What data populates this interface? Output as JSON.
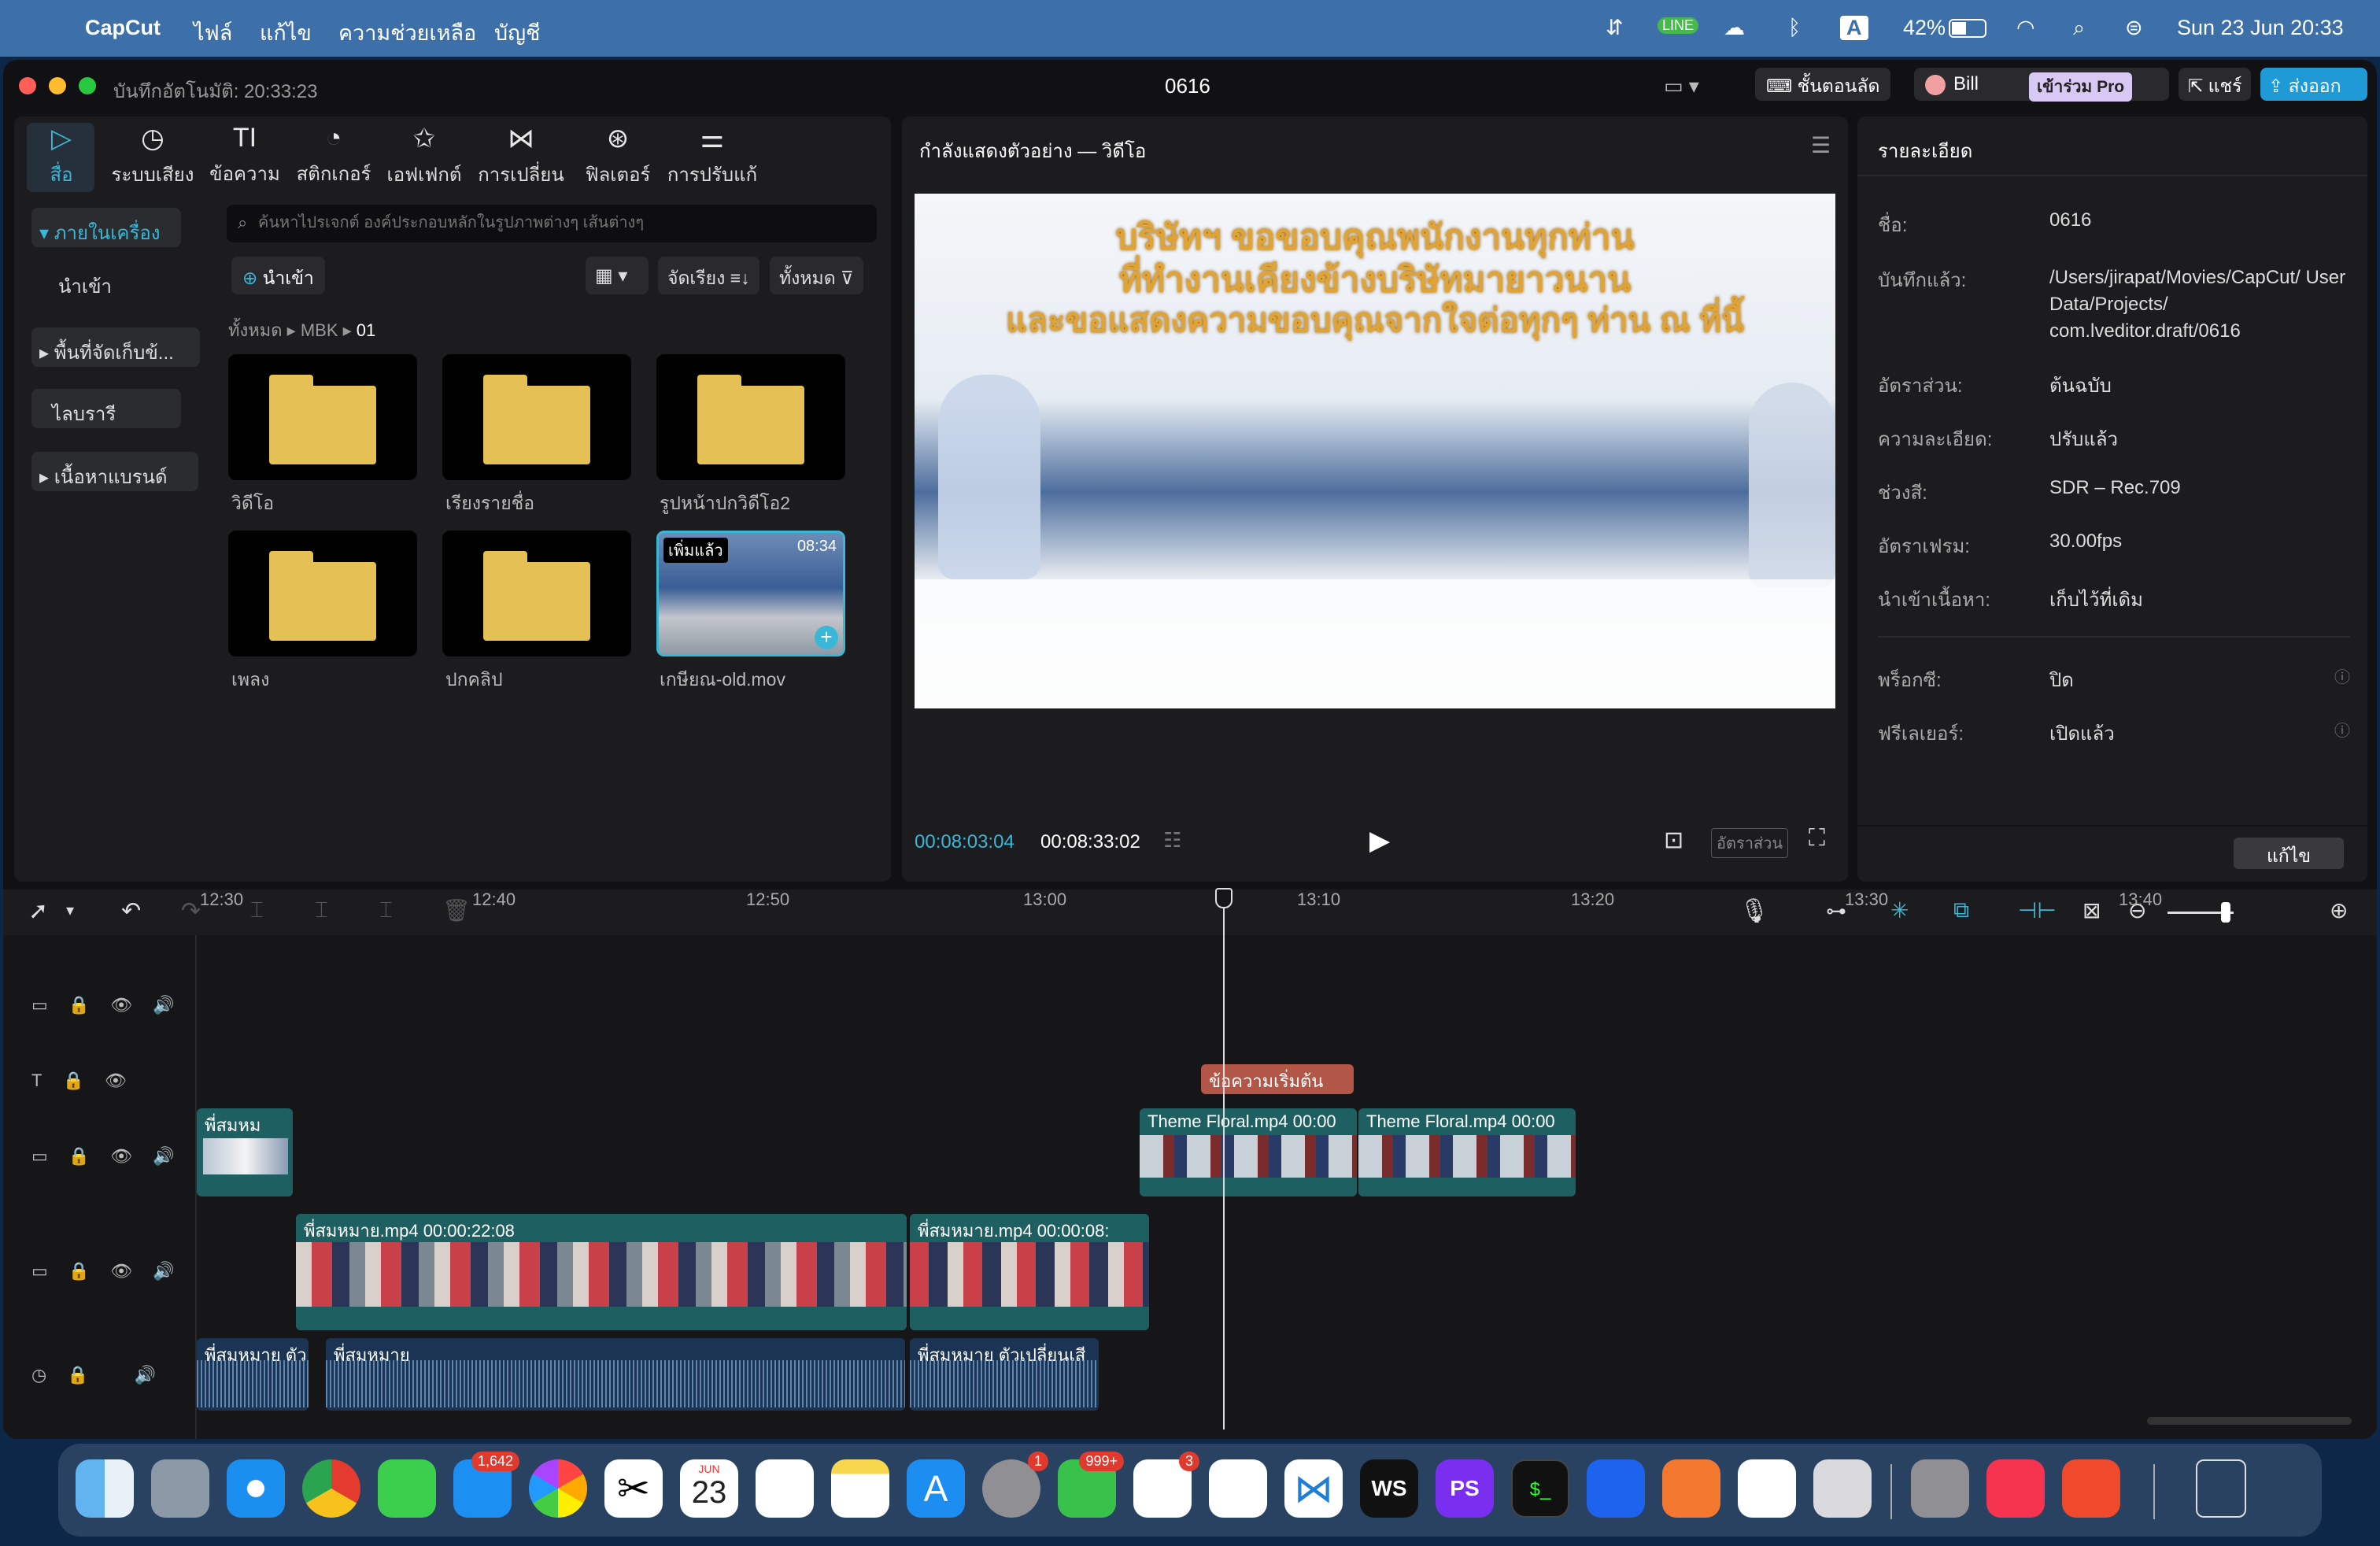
{
  "menubar": {
    "apple": "",
    "app": "CapCut",
    "items": [
      "ไฟล์",
      "แก้ไข",
      "ความช่วยเหลือ",
      "บัญชี"
    ],
    "battery": "42%",
    "clock": "Sun 23 Jun  20:33",
    "input": "A"
  },
  "window": {
    "autosave": "บันทึกอัตโนมัติ: 20:33:23",
    "project_title": "0616",
    "shortcuts": "ชั้นตอนลัด",
    "user": "Bill",
    "pro": "เข้าร่วม Pro",
    "share": "แชร์",
    "export": "ส่งออก"
  },
  "toolbar": [
    "สื่อ",
    "ระบบเสียง",
    "ข้อความ",
    "สติกเกอร์",
    "เอฟเฟกต์",
    "การเปลี่ยน",
    "ฟิลเตอร์",
    "การปรับแก้"
  ],
  "sidebar": {
    "local": "ภายในเครื่อง",
    "import": "นำเข้า",
    "space": "พื้นที่จัดเก็บข้...",
    "library": "ไลบรารี",
    "brand": "เนื้อหาแบรนด์"
  },
  "media": {
    "search_placeholder": "ค้นหาไปรเจกต์ องค์ประกอบหลักในรูปภาพต่างๆ เส้นต่างๆ",
    "import_btn": "นำเข้า",
    "sort": "จัดเรียง",
    "filter": "ทั้งหมด",
    "breadcrumb": [
      "ทั้งหมด",
      "MBK",
      "01"
    ],
    "folders": [
      "วิดีโอ",
      "เรียงรายชื่อ",
      "รูปหน้าปกวิดีโอ2",
      "เพลง",
      "ปกคลิป"
    ],
    "video": {
      "name": "เกษียณ-old.mov",
      "badge": "เพิ่มแล้ว",
      "duration": "08:34"
    }
  },
  "preview": {
    "header": "กำลังแสดงตัวอย่าง — วิดีโอ",
    "line1": "บริษัทฯ ขอขอบคุณพนักงานทุกท่าน",
    "line2": "ที่ทำงานเคียงข้างบริษัทมายาวนาน",
    "line3": "และขอแสดงความขอบคุณจากใจต่อทุกๆ ท่าน ณ ที่นี้",
    "time_current": "00:08:03:04",
    "time_total": "00:08:33:02",
    "ratio": "อัตราส่วน"
  },
  "details": {
    "header": "รายละเอียด",
    "rows": [
      {
        "k": "ชื่อ:",
        "v": "0616"
      },
      {
        "k": "บันทึกแล้ว:",
        "v": "/Users/jirapat/Movies/CapCut/ User Data/Projects/ com.lveditor.draft/0616"
      },
      {
        "k": "อัตราส่วน:",
        "v": "ต้นฉบับ"
      },
      {
        "k": "ความละเอียด:",
        "v": "ปรับแล้ว"
      },
      {
        "k": "ช่วงสี:",
        "v": "SDR – Rec.709"
      },
      {
        "k": "อัตราเฟรม:",
        "v": "30.00fps"
      },
      {
        "k": "นำเข้าเนื้อหา:",
        "v": "เก็บไว้ที่เดิม"
      },
      {
        "k": "พร็อกซี:",
        "v": "ปิด"
      },
      {
        "k": "ฟรีเลเยอร์:",
        "v": "เปิดแล้ว"
      }
    ],
    "edit": "แก้ไข"
  },
  "timeline": {
    "ticks": [
      "12:30",
      "12:40",
      "12:50",
      "13:00",
      "13:10",
      "13:20",
      "13:30",
      "13:40"
    ],
    "text_clip": "ข้อความเริ่มต้น",
    "clip_a": "พี่สมหม",
    "clip_theme1": "Theme  Floral.mp4  00:00",
    "clip_theme2": "Theme  Floral.mp4  00:00",
    "clip_main1": "พี่สมหมาย.mp4   00:00:22:08",
    "clip_main2": "พี่สมหมาย.mp4   00:00:08:",
    "audio1": "พี่สมหมาย    ตัว",
    "audio2": "พี่สมหมาย",
    "audio3": "พี่สมหมาย    ตัวเปลี่ยนเสี"
  },
  "dock": {
    "mail_badge": "1,642",
    "settings_badge": "1",
    "line_badge": "999+",
    "slack_badge": "3",
    "cal_month": "JUN",
    "cal_day": "23",
    "ws": "WS",
    "ps": "PS",
    "term": "$_"
  },
  "colors": {
    "accent": "#3ab7d6",
    "export": "#1f9ad6",
    "text_clip": "#b25748"
  }
}
